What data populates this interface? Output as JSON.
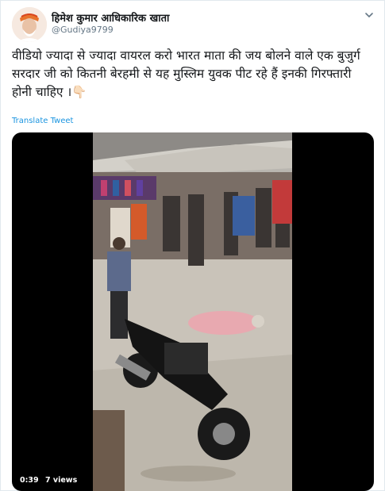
{
  "tweet": {
    "author_name": "हिमेश कुमार आधिकारिक खाता",
    "author_handle": "@Gudiya9799",
    "text": "वीडियो ज्यादा से ज्यादा वायरल करो भारत माता की जय बोलने वाले एक बुजुर्ग सरदार जी को कितनी बेरहमी से यह मुस्लिम युवक पीट रहे हैं इनकी गिरफ्तारी होनी चाहिए ।👇🏻",
    "translate_label": "Translate Tweet"
  },
  "video": {
    "duration": "0:39",
    "views": "7 views"
  },
  "colors": {
    "link": "#1b95e0",
    "text": "#14171a",
    "muted": "#657786"
  },
  "icons": [
    "chevron-down-icon",
    "avatar-image",
    "video-thumbnail"
  ]
}
